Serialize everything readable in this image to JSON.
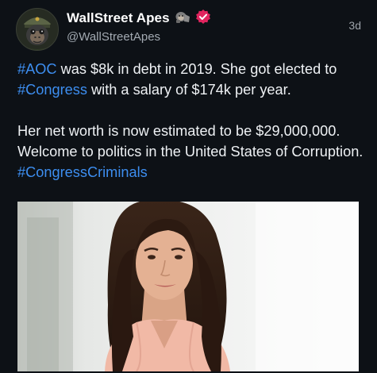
{
  "tweet": {
    "display_name": "WallStreet Apes",
    "handle": "@WallStreetApes",
    "time": "3d",
    "paragraph1": {
      "tag1": "#AOC",
      "text1": " was $8k in debt in 2019. She got elected to ",
      "tag2": "#Congress",
      "text2": " with a salary of $174k per year."
    },
    "paragraph2": {
      "text1": "Her net worth is now estimated to be $29,000,000. Welcome to politics in the United States of Corruption. ",
      "tag1": "#CongressCriminals"
    }
  },
  "colors": {
    "background": "#0d1116",
    "hashtag": "#3d8ef0",
    "verified_badge": "#e0245e"
  },
  "icons": [
    "ape-avatar",
    "gorilla-emoji-icon",
    "verified-badge-icon"
  ]
}
